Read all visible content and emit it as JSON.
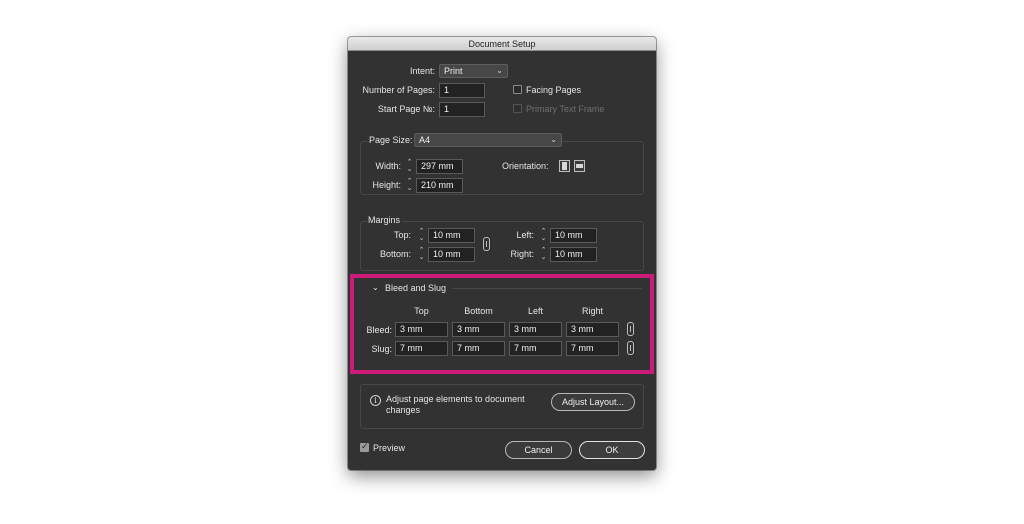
{
  "dialog": {
    "title": "Document Setup",
    "intent": {
      "label": "Intent:",
      "value": "Print"
    },
    "num_pages": {
      "label": "Number of Pages:",
      "value": "1"
    },
    "start_page": {
      "label": "Start Page №:",
      "value": "1"
    },
    "facing_pages": {
      "label": "Facing Pages",
      "checked": false
    },
    "primary_text_frame": {
      "label": "Primary Text Frame",
      "checked": false,
      "enabled": false
    },
    "page_size": {
      "label": "Page Size:",
      "value": "A4"
    },
    "width": {
      "label": "Width:",
      "value": "297 mm"
    },
    "height": {
      "label": "Height:",
      "value": "210 mm"
    },
    "orientation": {
      "label": "Orientation:"
    },
    "margins": {
      "title": "Margins",
      "top": {
        "label": "Top:",
        "value": "10 mm"
      },
      "bottom": {
        "label": "Bottom:",
        "value": "10 mm"
      },
      "left": {
        "label": "Left:",
        "value": "10 mm"
      },
      "right": {
        "label": "Right:",
        "value": "10 mm"
      }
    },
    "bleed_slug": {
      "title": "Bleed and Slug",
      "columns": [
        "Top",
        "Bottom",
        "Left",
        "Right"
      ],
      "bleed": {
        "label": "Bleed:",
        "values": [
          "3 mm",
          "3 mm",
          "3 mm",
          "3 mm"
        ]
      },
      "slug": {
        "label": "Slug:",
        "values": [
          "7 mm",
          "7 mm",
          "7 mm",
          "7 mm"
        ]
      }
    },
    "adjust": {
      "text_line1": "Adjust page elements to document",
      "text_line2": "changes",
      "button": "Adjust Layout..."
    },
    "preview": {
      "label": "Preview",
      "checked": true
    },
    "cancel_button": "Cancel",
    "ok_button": "OK"
  },
  "colors": {
    "highlight": "#cc1a7a",
    "dialog_bg": "#323232",
    "field_bg": "#222222"
  }
}
